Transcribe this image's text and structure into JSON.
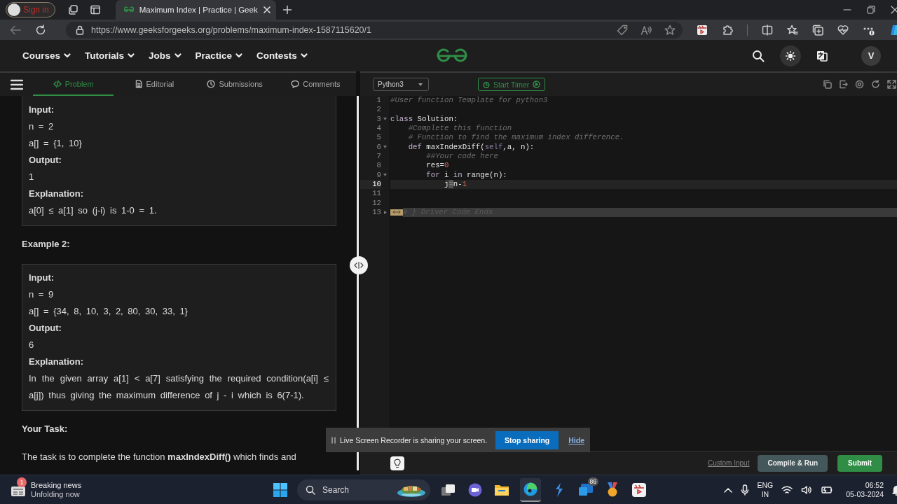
{
  "browser": {
    "sign_in": "Sign in",
    "tab_title": "Maximum Index | Practice | Geek",
    "url": "https://www.geeksforgeeks.org/problems/maximum-index-1587115620/1"
  },
  "site_nav": {
    "items": [
      "Courses",
      "Tutorials",
      "Jobs",
      "Practice",
      "Contests"
    ],
    "avatar": "V"
  },
  "problem_tabs": [
    {
      "label": "Problem",
      "kind": "code",
      "selected": true
    },
    {
      "label": "Editorial",
      "kind": "document",
      "selected": false
    },
    {
      "label": "Submissions",
      "kind": "clock",
      "selected": false
    },
    {
      "label": "Comments",
      "kind": "comment",
      "selected": false
    }
  ],
  "problem_content": [
    {
      "kind": "box",
      "lines": [
        {
          "kind": "label",
          "text": "Input:"
        },
        {
          "kind": "value",
          "text": "n = 2"
        },
        {
          "kind": "value",
          "text": "a[] = {1, 10}"
        },
        {
          "kind": "label",
          "text": "Output:"
        },
        {
          "kind": "value",
          "text": "1"
        },
        {
          "kind": "label",
          "text": "Explanation:"
        },
        {
          "kind": "value",
          "text": "a[0] ≤ a[1] so (j-i) is 1-0 = 1."
        }
      ]
    },
    {
      "kind": "heading",
      "text": "Example 2:"
    },
    {
      "kind": "box",
      "lines": [
        {
          "kind": "label",
          "text": "Input:"
        },
        {
          "kind": "value",
          "text": "n = 9"
        },
        {
          "kind": "value",
          "text": "a[] = {34, 8, 10, 3, 2, 80, 30, 33, 1}"
        },
        {
          "kind": "label",
          "text": "Output:"
        },
        {
          "kind": "value",
          "text": "6"
        },
        {
          "kind": "label",
          "text": "Explanation:"
        },
        {
          "kind": "value",
          "text": "In the given array a[1] < a[7] satisfying the required condition(a[i] ≤ a[j]) thus giving the maximum difference of j - i which is 6(7-1)."
        }
      ]
    },
    {
      "kind": "heading",
      "text": "Your Task:"
    },
    {
      "kind": "paragraph",
      "text": "The task is to complete the function **maxIndexDiff()** which finds and"
    }
  ],
  "editor": {
    "language": "Python3",
    "timer": "Start Timer",
    "lines": [
      {
        "number": "1",
        "foldable": false,
        "folded": false,
        "active": false,
        "tokens": [
          {
            "t": "#User function Template for python3",
            "kind": "comment"
          }
        ]
      },
      {
        "number": "2",
        "foldable": false,
        "folded": false,
        "active": false
      },
      {
        "number": "3",
        "foldable": true,
        "folded": false,
        "active": false,
        "tokens": [
          {
            "t": "class",
            "kind": "keyword"
          },
          {
            "t": " Solution:",
            "kind": "plain"
          }
        ]
      },
      {
        "number": "4",
        "foldable": false,
        "folded": false,
        "active": false,
        "tokens": [
          {
            "t": "    #Complete this function",
            "kind": "comment"
          }
        ]
      },
      {
        "number": "5",
        "foldable": false,
        "folded": false,
        "active": false,
        "tokens": [
          {
            "t": "    # Function to find the maximum index difference.",
            "kind": "comment"
          }
        ]
      },
      {
        "number": "6",
        "foldable": true,
        "folded": false,
        "active": false,
        "tokens": [
          {
            "t": "    def",
            "kind": "keyword"
          },
          {
            "t": " maxIndexDiff(",
            "kind": "plain"
          },
          {
            "t": "self",
            "kind": "self"
          },
          {
            "t": ",a, n):",
            "kind": "plain"
          }
        ]
      },
      {
        "number": "7",
        "foldable": false,
        "folded": false,
        "active": false,
        "tokens": [
          {
            "t": "        ##Your code here",
            "kind": "comment"
          }
        ]
      },
      {
        "number": "8",
        "foldable": false,
        "folded": false,
        "active": false,
        "tokens": [
          {
            "t": "        res=",
            "kind": "plain"
          },
          {
            "t": "0",
            "kind": "number"
          }
        ]
      },
      {
        "number": "9",
        "foldable": true,
        "folded": false,
        "active": false,
        "tokens": [
          {
            "t": "        for",
            "kind": "keyword"
          },
          {
            "t": " i ",
            "kind": "plain"
          },
          {
            "t": "in",
            "kind": "keyword"
          },
          {
            "t": " range(n):",
            "kind": "plain"
          }
        ]
      },
      {
        "number": "10",
        "foldable": false,
        "folded": false,
        "active": true,
        "tokens": [
          {
            "t": "            j",
            "kind": "plain"
          },
          {
            "t": "=",
            "kind": "cursor"
          },
          {
            "t": "n-",
            "kind": "plain"
          },
          {
            "t": "1",
            "kind": "number"
          }
        ]
      },
      {
        "number": "11",
        "foldable": false,
        "folded": false,
        "active": false
      },
      {
        "number": "12",
        "foldable": false,
        "folded": false,
        "active": false
      },
      {
        "number": "13",
        "foldable": true,
        "folded": true,
        "active": false,
        "tokens": [
          {
            "t": "# } Driver Code Ends",
            "kind": "faded"
          }
        ]
      }
    ]
  },
  "actions": {
    "custom_input": "Custom Input",
    "compile": "Compile & Run",
    "submit": "Submit"
  },
  "share_bar": {
    "message": "Live Screen Recorder is sharing your screen.",
    "stop": "Stop sharing",
    "hide": "Hide"
  },
  "taskbar": {
    "news_badge": "1",
    "news_title": "Breaking news",
    "news_subtitle": "Unfolding now",
    "search": "Search",
    "mail_badge": "86",
    "lang_top": "ENG",
    "lang_bottom": "IN",
    "time": "06:52",
    "date": "05-03-2024"
  }
}
